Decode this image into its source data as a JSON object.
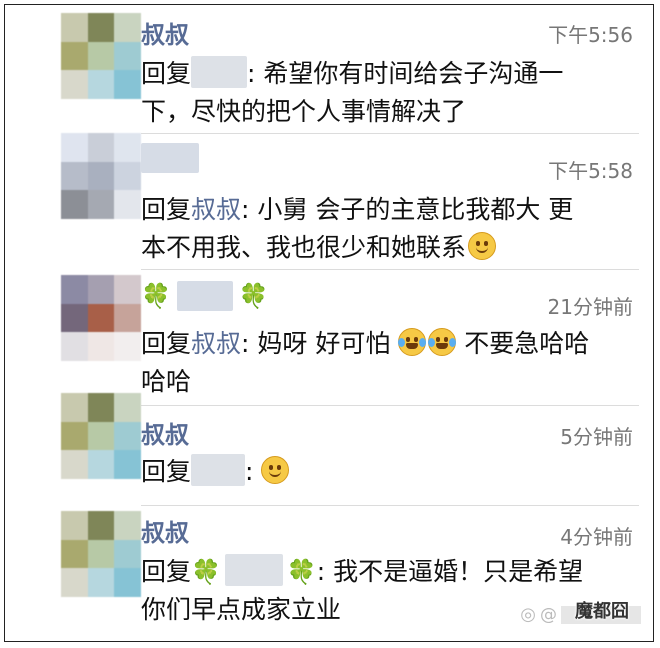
{
  "comments": [
    {
      "author": "叔叔",
      "time": "下午5:56",
      "reply_prefix": "回复",
      "reply_to": "",
      "text": ": 希望你有时间给会子沟通一下，尽快的把个人事情解决了",
      "line1": ": 希望你有时间给会子沟通一",
      "line2": "下，尽快的把个人事情解决了",
      "avatar_colors": [
        "#c8c9ae",
        "#7f8658",
        "#c9d4c0",
        "#a9a96e",
        "#b7c9a6",
        "#9ecbd2",
        "#d8d8cb",
        "#b6d7df",
        "#86c3d5"
      ]
    },
    {
      "author": "",
      "time": "下午5:58",
      "reply_prefix": "回复",
      "reply_to": "叔叔",
      "line1": ": 小舅 会子的主意比我都大 更",
      "line2": "本不用我、我也很少和她联系",
      "emoji": "smile",
      "avatar_colors": [
        "#dfe4ef",
        "#c9ced8",
        "#dfe5ee",
        "#b6bcc9",
        "#a9b0bf",
        "#ccd3df",
        "#8c8f96",
        "#a5a9b2",
        "#e3e6ec"
      ]
    },
    {
      "author": "🍀 🍀",
      "time": "21分钟前",
      "reply_prefix": "回复",
      "reply_to": "叔叔",
      "line1_a": ": 妈呀 好可怕",
      "line1_b": " 不要急哈哈",
      "line2": "哈哈",
      "emoji": "tears",
      "avatar_colors": [
        "#8c8aa4",
        "#a59fb0",
        "#d3c8cc",
        "#74677b",
        "#a85f48",
        "#c6a39a",
        "#e1dfe3",
        "#efe7e5",
        "#f2eeee"
      ]
    },
    {
      "author": "叔叔",
      "time": "5分钟前",
      "reply_prefix": "回复",
      "reply_to": "",
      "line1": ":",
      "emoji": "smile",
      "avatar_colors": [
        "#c8c9ae",
        "#7f8658",
        "#c9d4c0",
        "#a9a96e",
        "#b7c9a6",
        "#9ecbd2",
        "#d8d8cb",
        "#b6d7df",
        "#86c3d5"
      ]
    },
    {
      "author": "叔叔",
      "time": "4分钟前",
      "reply_prefix": "回复",
      "reply_to": "🍀 🍀",
      "line1": ": 我不是逼婚！只是希望",
      "line2": "你们早点成家立业",
      "avatar_colors": [
        "#c8c9ae",
        "#7f8658",
        "#c9d4c0",
        "#a9a96e",
        "#b7c9a6",
        "#9ecbd2",
        "#d8d8cb",
        "#b6d7df",
        "#86c3d5"
      ]
    }
  ],
  "watermark": {
    "prefix": "@",
    "logo": "魔都囧"
  },
  "colors": {
    "name": "#576b95",
    "time": "#777777",
    "text": "#111111",
    "clover": "#3ba03b"
  }
}
